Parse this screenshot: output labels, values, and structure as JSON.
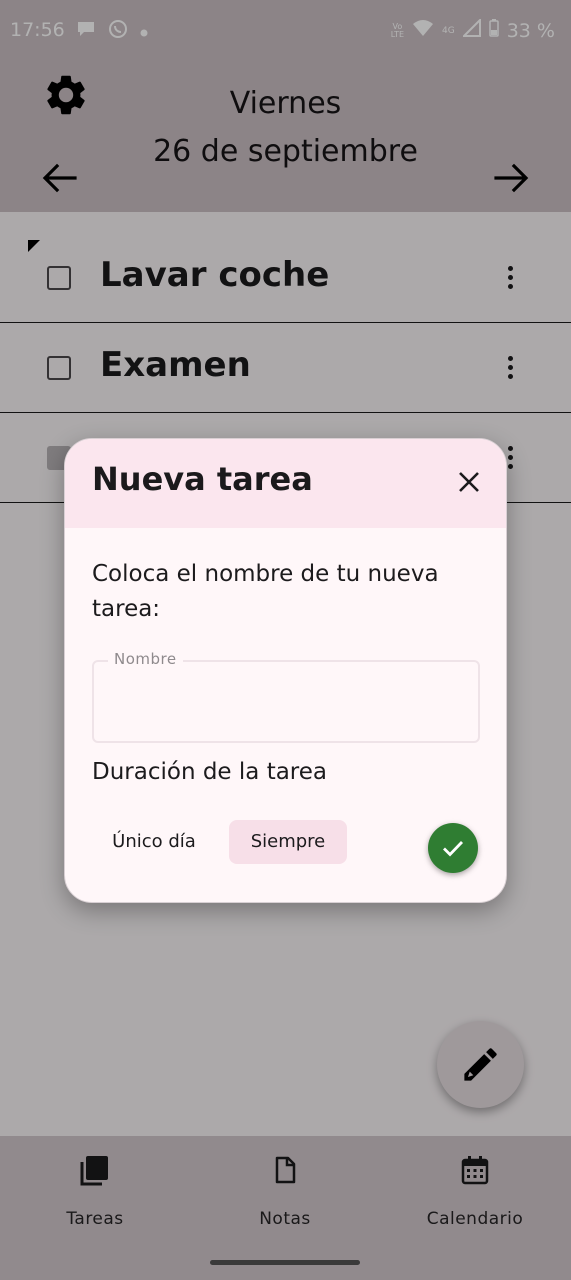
{
  "status_bar": {
    "time": "17:56",
    "left_icons": [
      "chat-bubble-icon",
      "whatsapp-icon",
      "dot-icon"
    ],
    "network_label": "4G",
    "volte_label_top": "Vo",
    "volte_label_bottom": "LTE",
    "battery": "33 %"
  },
  "header": {
    "day_name": "Viernes",
    "date": "26 de septiembre",
    "icons": [
      "gear-icon",
      "arrow-left-icon",
      "arrow-right-icon"
    ]
  },
  "tasks": [
    {
      "name": "Lavar coche",
      "checked": false
    },
    {
      "name": "Examen",
      "checked": false
    },
    {
      "name": "",
      "checked": true
    }
  ],
  "fab": {
    "icon": "pencil-icon"
  },
  "bottom_nav": {
    "items": [
      {
        "label": "Tareas",
        "icon": "tasks-icon"
      },
      {
        "label": "Notas",
        "icon": "note-icon"
      },
      {
        "label": "Calendario",
        "icon": "calendar-icon"
      }
    ]
  },
  "dialog": {
    "title": "Nueva tarea",
    "prompt": "Coloca el nombre de tu nueva tarea:",
    "field_label": "Nombre",
    "field_value": "",
    "duration_label": "Duración de la tarea",
    "options": [
      "Único día",
      "Siempre"
    ],
    "selected_option": "Siempre",
    "colors": {
      "confirm": "#2f7d32",
      "header_bg": "#fbe6ee",
      "selected_option_bg": "#f7dfe8"
    }
  }
}
